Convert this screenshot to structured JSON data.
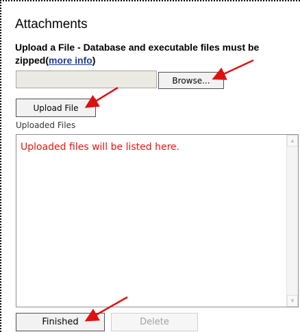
{
  "attachments": {
    "title": "Attachments",
    "upload_label": "Upload a File - Database and executable files must be zipped",
    "upload_label_paren_open": "(",
    "more_info_link": "more info",
    "upload_label_paren_close": ")",
    "browse_button": "Browse...",
    "upload_button": "Upload File",
    "uploaded_files_label": "Uploaded Files",
    "uploaded_placeholder": "Uploaded files will be listed here.",
    "finished_button": "Finished",
    "delete_button": "Delete"
  },
  "colors": {
    "annotation_arrow": "#e01010",
    "placeholder_text": "#f20e0e",
    "link": "#1f3c9c"
  },
  "icons": {
    "scroll_up": "scroll-up-arrow-icon",
    "scroll_down": "scroll-down-arrow-icon",
    "annotation": "red-arrow-icon"
  }
}
